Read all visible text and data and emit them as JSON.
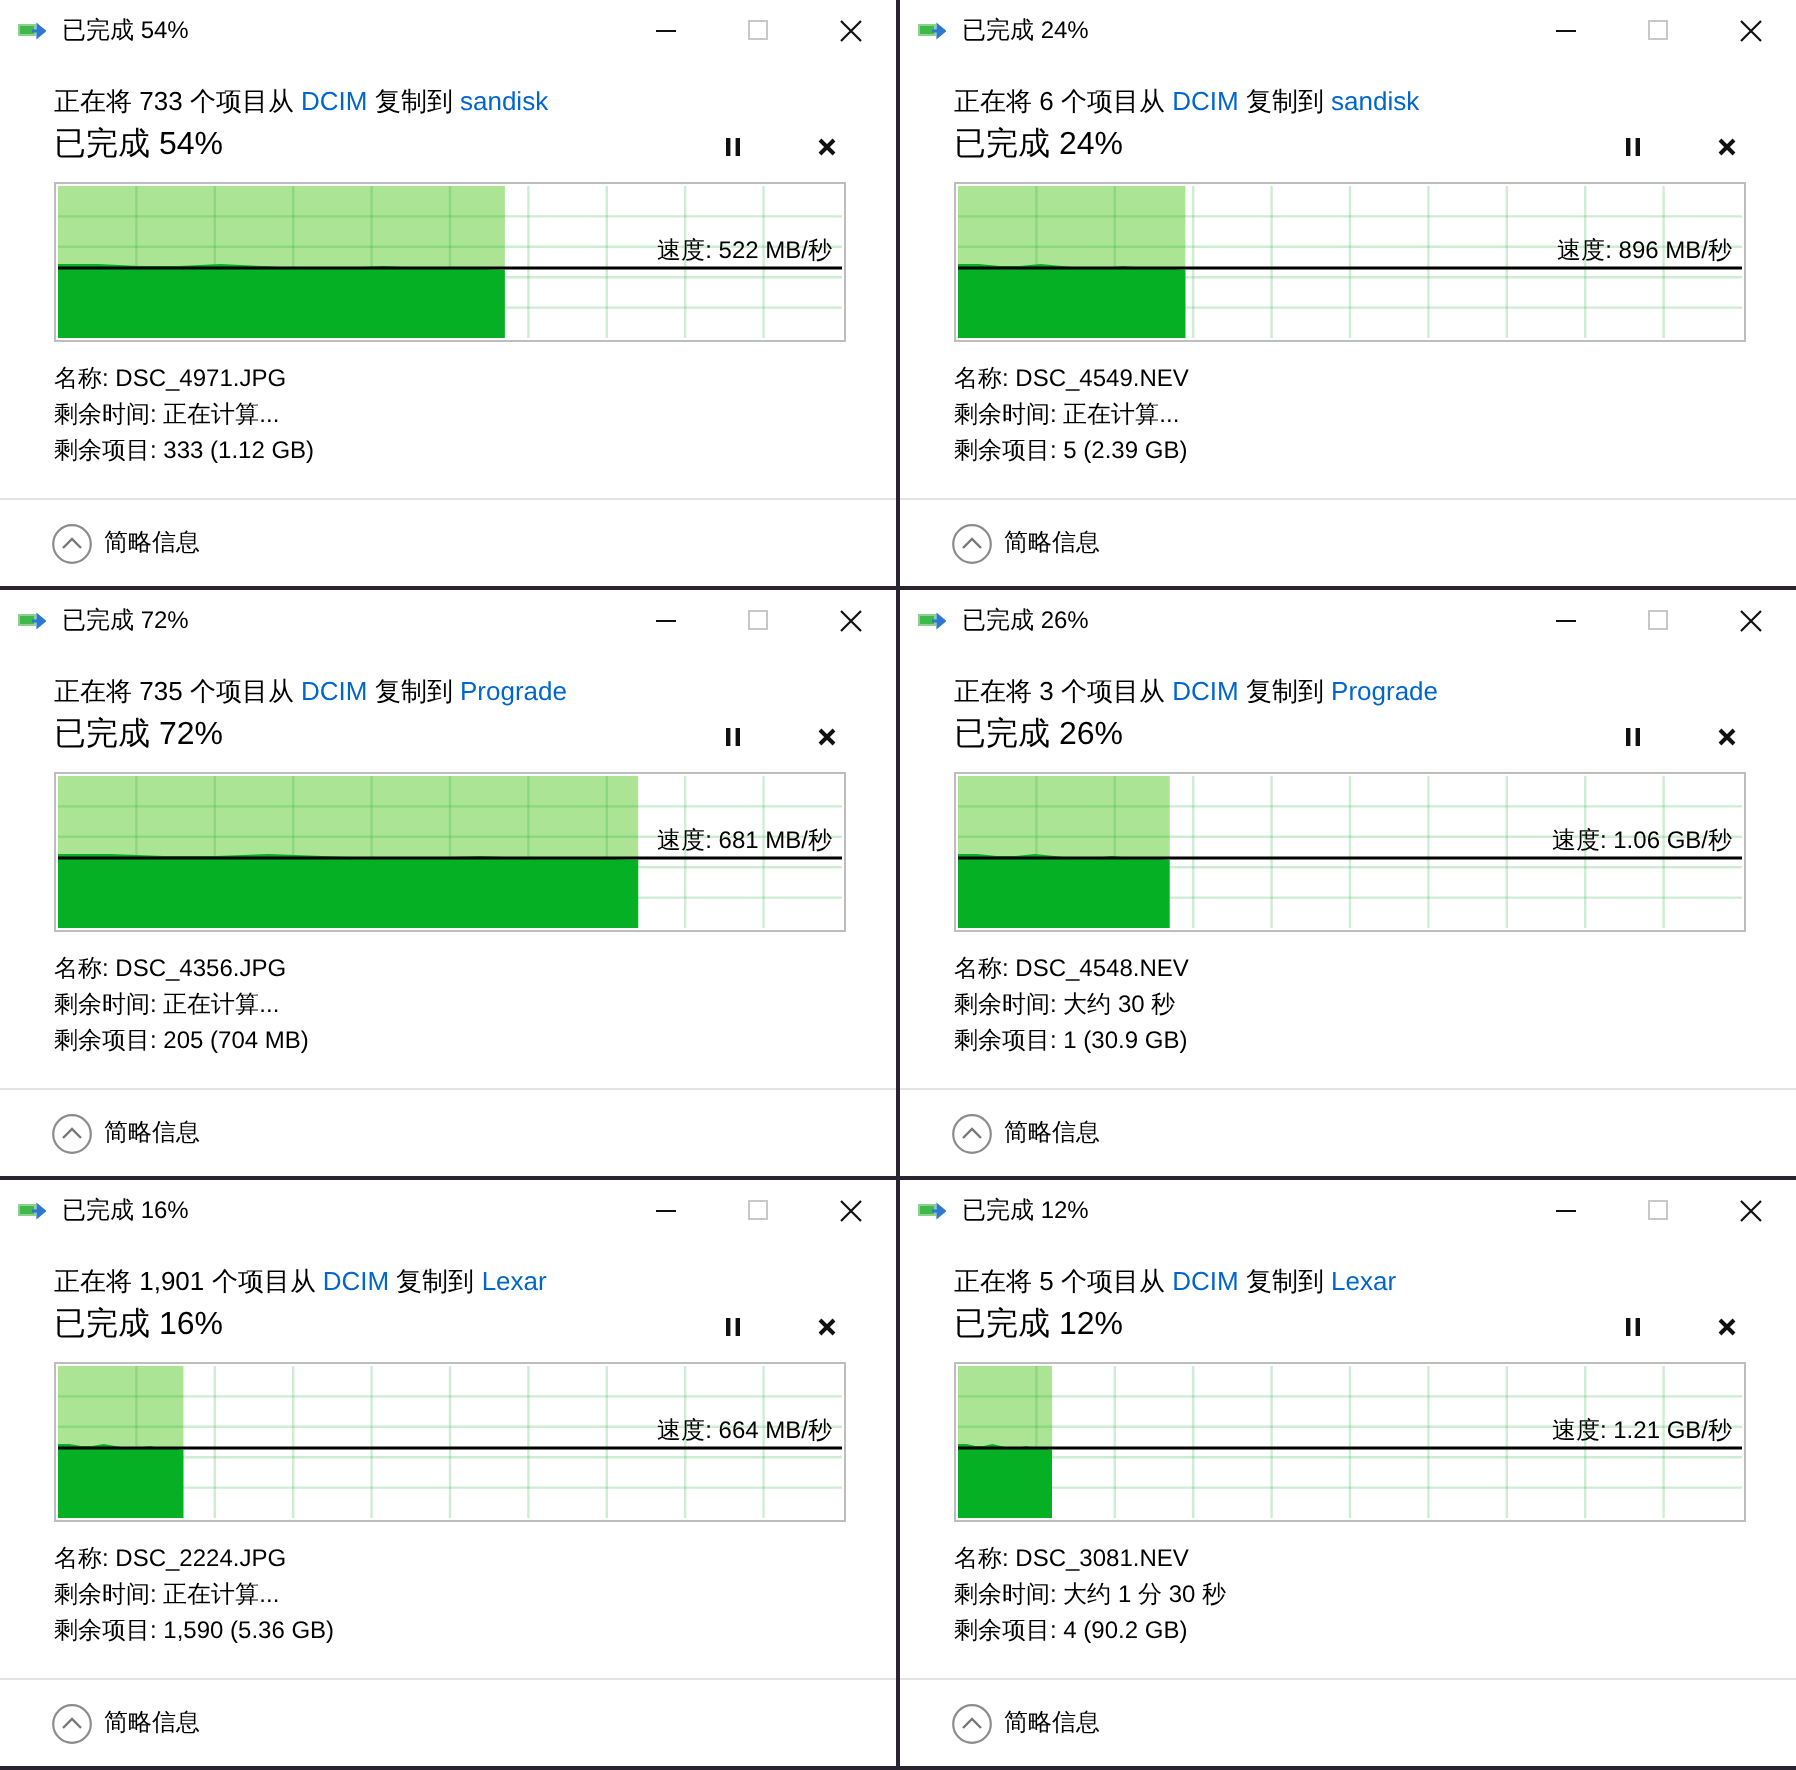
{
  "dialogs": [
    {
      "title": "已完成 54%",
      "maximize_disabled": true,
      "status": {
        "prefix": "正在将 733 个项目从",
        "source": "DCIM",
        "middle": "复制到",
        "destination": "sandisk"
      },
      "heading": "已完成 54%",
      "level": 0.57,
      "speed": "速度: 522 MB/秒",
      "details": [
        "名称: DSC_4971.JPG",
        "剩余时间: 正在计算...",
        "剩余项目: 333 (1.12 GB)"
      ],
      "footer": {
        "label": "简略信息",
        "details_expanded": true
      }
    },
    {
      "title": "已完成 24%",
      "maximize_disabled": true,
      "status": {
        "prefix": "正在将 6 个项目从",
        "source": "DCIM",
        "middle": "复制到",
        "destination": "sandisk"
      },
      "heading": "已完成 24%",
      "level": 0.29,
      "speed": "速度: 896 MB/秒",
      "details": [
        "名称: DSC_4549.NEV",
        "剩余时间: 正在计算...",
        "剩余项目: 5 (2.39 GB)"
      ],
      "footer": {
        "label": "简略信息",
        "details_expanded": true
      }
    },
    {
      "title": "已完成 72%",
      "maximize_disabled": true,
      "status": {
        "prefix": "正在将 735 个项目从",
        "source": "DCIM",
        "middle": "复制到",
        "destination": "Prograde"
      },
      "heading": "已完成 72%",
      "level": 0.74,
      "speed": "速度: 681 MB/秒",
      "details": [
        "名称: DSC_4356.JPG",
        "剩余时间: 正在计算...",
        "剩余项目: 205 (704 MB)"
      ],
      "footer": {
        "label": "简略信息",
        "details_expanded": true
      }
    },
    {
      "title": "已完成 26%",
      "maximize_disabled": true,
      "status": {
        "prefix": "正在将 3 个项目从",
        "source": "DCIM",
        "middle": "复制到",
        "destination": "Prograde"
      },
      "heading": "已完成 26%",
      "level": 0.27,
      "speed": "速度: 1.06 GB/秒",
      "details": [
        "名称: DSC_4548.NEV",
        "剩余时间: 大约 30 秒",
        "剩余项目: 1 (30.9 GB)"
      ],
      "footer": {
        "label": "简略信息",
        "details_expanded": true
      }
    },
    {
      "title": "已完成 16%",
      "maximize_disabled": true,
      "status": {
        "prefix": "正在将 1,901 个项目从",
        "source": "DCIM",
        "middle": "复制到",
        "destination": "Lexar"
      },
      "heading": "已完成 16%",
      "level": 0.16,
      "speed": "速度: 664 MB/秒",
      "details": [
        "名称: DSC_2224.JPG",
        "剩余时间: 正在计算...",
        "剩余项目: 1,590 (5.36 GB)"
      ],
      "footer": {
        "label": "简略信息",
        "details_expanded": true
      }
    },
    {
      "title": "已完成 12%",
      "maximize_disabled": true,
      "status": {
        "prefix": "正在将 5 个项目从",
        "source": "DCIM",
        "middle": "复制到",
        "destination": "Lexar"
      },
      "heading": "已完成 12%",
      "level": 0.12,
      "speed": "速度: 1.21 GB/秒",
      "details": [
        "名称: DSC_3081.NEV",
        "剩余时间: 大约 1 分 30 秒",
        "剩余项目: 4 (90.2 GB)"
      ],
      "footer": {
        "label": "简略信息",
        "details_expanded": true
      }
    }
  ]
}
